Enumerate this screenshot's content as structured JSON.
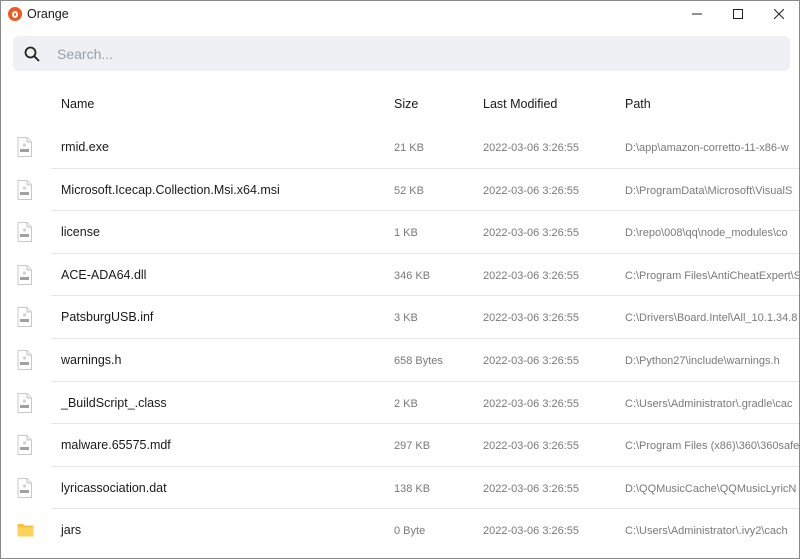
{
  "window": {
    "title": "Orange",
    "accent": "#f05a22"
  },
  "search": {
    "placeholder": "Search..."
  },
  "columns": {
    "name": "Name",
    "size": "Size",
    "modified": "Last Modified",
    "path": "Path"
  },
  "files": [
    {
      "icon": "exe-file-icon",
      "name": "rmid.exe",
      "size": "21 KB",
      "modified": "2022-03-06 3:26:55",
      "path": "D:\\app\\amazon-corretto-11-x86-w"
    },
    {
      "icon": "msi-file-icon",
      "name": "Microsoft.Icecap.Collection.Msi.x64.msi",
      "size": "52 KB",
      "modified": "2022-03-06 3:26:55",
      "path": "D:\\ProgramData\\Microsoft\\VisualS"
    },
    {
      "icon": "license-file-icon",
      "name": "license",
      "size": "1 KB",
      "modified": "2022-03-06 3:26:55",
      "path": "D:\\repo\\008\\qq\\node_modules\\co"
    },
    {
      "icon": "dll-file-icon",
      "name": "ACE-ADA64.dll",
      "size": "346 KB",
      "modified": "2022-03-06 3:26:55",
      "path": "C:\\Program Files\\AntiCheatExpert\\S"
    },
    {
      "icon": "inf-file-icon",
      "name": "PatsburgUSB.inf",
      "size": "3 KB",
      "modified": "2022-03-06 3:26:55",
      "path": "C:\\Drivers\\Board.Intel\\All_10.1.34.8"
    },
    {
      "icon": "h-file-icon",
      "name": "warnings.h",
      "size": "658 Bytes",
      "modified": "2022-03-06 3:26:55",
      "path": "D:\\Python27\\include\\warnings.h"
    },
    {
      "icon": "class-file-icon",
      "name": "_BuildScript_.class",
      "size": "2 KB",
      "modified": "2022-03-06 3:26:55",
      "path": "C:\\Users\\Administrator\\.gradle\\cac"
    },
    {
      "icon": "mdf-file-icon",
      "name": "malware.65575.mdf",
      "size": "297 KB",
      "modified": "2022-03-06 3:26:55",
      "path": "C:\\Program Files (x86)\\360\\360safe"
    },
    {
      "icon": "dat-file-icon",
      "name": "lyricassociation.dat",
      "size": "138 KB",
      "modified": "2022-03-06 3:26:55",
      "path": "D:\\QQMusicCache\\QQMusicLyricN"
    },
    {
      "icon": "folder-icon",
      "name": "jars",
      "size": "0 Byte",
      "modified": "2022-03-06 3:26:55",
      "path": "C:\\Users\\Administrator\\.ivy2\\cach"
    }
  ]
}
